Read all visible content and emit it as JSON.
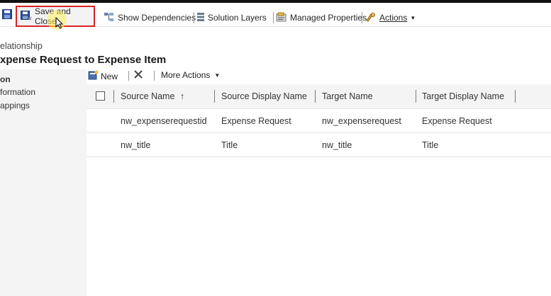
{
  "toolbar": {
    "save_and_close": "Save and Close",
    "show_dependencies": "Show Dependencies",
    "solution_layers": "Solution Layers",
    "managed_properties": "Managed Properties",
    "actions": "Actions"
  },
  "header": {
    "subtitle": "elationship",
    "title": "xpense Request to Expense Item"
  },
  "leftnav": {
    "items": [
      "on",
      "formation",
      "appings"
    ]
  },
  "grid": {
    "new_label": "New",
    "more_actions": "More Actions",
    "columns": [
      "Source Name",
      "Source Display Name",
      "Target Name",
      "Target Display Name"
    ],
    "sort_indicator": "↑",
    "rows": [
      [
        "nw_expenserequestid",
        "Expense Request",
        "nw_expenserequest",
        "Expense Request"
      ],
      [
        "nw_title",
        "Title",
        "nw_title",
        "Title"
      ]
    ]
  },
  "colors": {
    "highlight_border": "#d9232b",
    "header_bg": "#f4f4f4"
  }
}
